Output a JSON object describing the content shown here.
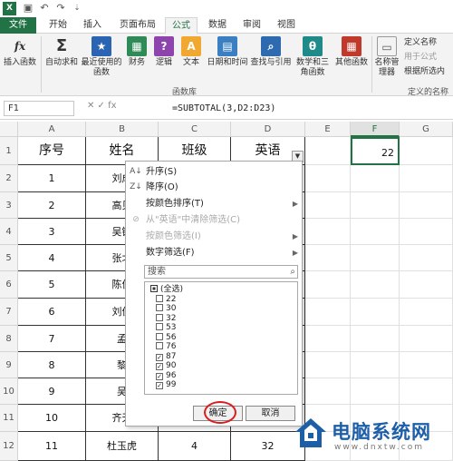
{
  "titlebar": {
    "app_icon": "X",
    "quick_access": [
      "save-icon",
      "undo-icon",
      "redo-icon",
      "customize-icon"
    ]
  },
  "tabs": [
    "文件",
    "开始",
    "插入",
    "页面布局",
    "公式",
    "数据",
    "审阅",
    "视图"
  ],
  "active_tab": "公式",
  "ribbon": {
    "buttons": [
      {
        "label": "插入函数",
        "icon": "fx-icon",
        "glyph": "fx"
      },
      {
        "label": "自动求和",
        "icon": "sum-icon",
        "glyph": "Σ"
      },
      {
        "label": "最近使用的函数",
        "icon": "star-icon",
        "glyph": "★"
      },
      {
        "label": "财务",
        "icon": "finance-icon",
        "glyph": "▦"
      },
      {
        "label": "逻辑",
        "icon": "logic-icon",
        "glyph": "?"
      },
      {
        "label": "文本",
        "icon": "text-icon",
        "glyph": "A"
      },
      {
        "label": "日期和时间",
        "icon": "calendar-icon",
        "glyph": "▤"
      },
      {
        "label": "查找与引用",
        "icon": "lookup-icon",
        "glyph": "⌕"
      },
      {
        "label": "数学和三角函数",
        "icon": "math-icon",
        "glyph": "θ"
      },
      {
        "label": "其他函数",
        "icon": "more-functions-icon",
        "glyph": "▦"
      },
      {
        "label": "名称管理器",
        "icon": "name-manager-icon",
        "glyph": "▭"
      }
    ],
    "group_label": "函数库",
    "names_group_label": "定义的名称",
    "small_buttons": [
      {
        "label": "定义名称",
        "enabled": true
      },
      {
        "label": "用于公式",
        "enabled": false
      },
      {
        "label": "根据所选内",
        "enabled": true
      }
    ]
  },
  "formula_bar": {
    "name_box": "F1",
    "icons": "✕  ✓  fx",
    "formula": "=SUBTOTAL(3,D2:D23)"
  },
  "grid": {
    "columns": [
      "A",
      "B",
      "C",
      "D",
      "E",
      "F",
      "G"
    ],
    "selected_column": "F",
    "rows": [
      "1",
      "2",
      "3",
      "4",
      "5",
      "6",
      "7",
      "8",
      "9",
      "10",
      "11",
      "12"
    ],
    "headers": [
      "序号",
      "姓名",
      "班级",
      "英语"
    ],
    "data": [
      [
        "1",
        "刘成"
      ],
      [
        "2",
        "高贝"
      ],
      [
        "3",
        "吴键"
      ],
      [
        "4",
        "张北"
      ],
      [
        "5",
        "陈佳"
      ],
      [
        "6",
        "刘佳"
      ],
      [
        "7",
        "孟"
      ],
      [
        "8",
        "黎"
      ],
      [
        "9",
        "吴"
      ],
      [
        "10",
        "齐天"
      ],
      [
        "11",
        "杜玉虎",
        "4",
        "32"
      ]
    ],
    "f1_value": "22"
  },
  "filter_menu": {
    "items": [
      {
        "label": "升序(S)",
        "enabled": true,
        "icon": "sort-asc-icon"
      },
      {
        "label": "降序(O)",
        "enabled": true,
        "icon": "sort-desc-icon"
      },
      {
        "label": "按颜色排序(T)",
        "enabled": true,
        "arrow": true
      },
      {
        "label": "从\"英语\"中清除筛选(C)",
        "enabled": false,
        "icon": "clear-filter-icon"
      },
      {
        "label": "按颜色筛选(I)",
        "enabled": false,
        "arrow": true
      },
      {
        "label": "数字筛选(F)",
        "enabled": true,
        "arrow": true
      }
    ],
    "search_placeholder": "搜索",
    "checklist": [
      {
        "label": "(全选)",
        "state": "partial"
      },
      {
        "label": "22",
        "state": "unchecked"
      },
      {
        "label": "30",
        "state": "unchecked"
      },
      {
        "label": "32",
        "state": "unchecked"
      },
      {
        "label": "53",
        "state": "unchecked"
      },
      {
        "label": "56",
        "state": "unchecked"
      },
      {
        "label": "76",
        "state": "unchecked"
      },
      {
        "label": "87",
        "state": "checked"
      },
      {
        "label": "90",
        "state": "checked"
      },
      {
        "label": "96",
        "state": "checked"
      },
      {
        "label": "99",
        "state": "checked"
      }
    ],
    "ok_label": "确定",
    "cancel_label": "取消"
  },
  "watermark": {
    "title": "电脑系统网",
    "url": "www.dnxtw.com"
  }
}
